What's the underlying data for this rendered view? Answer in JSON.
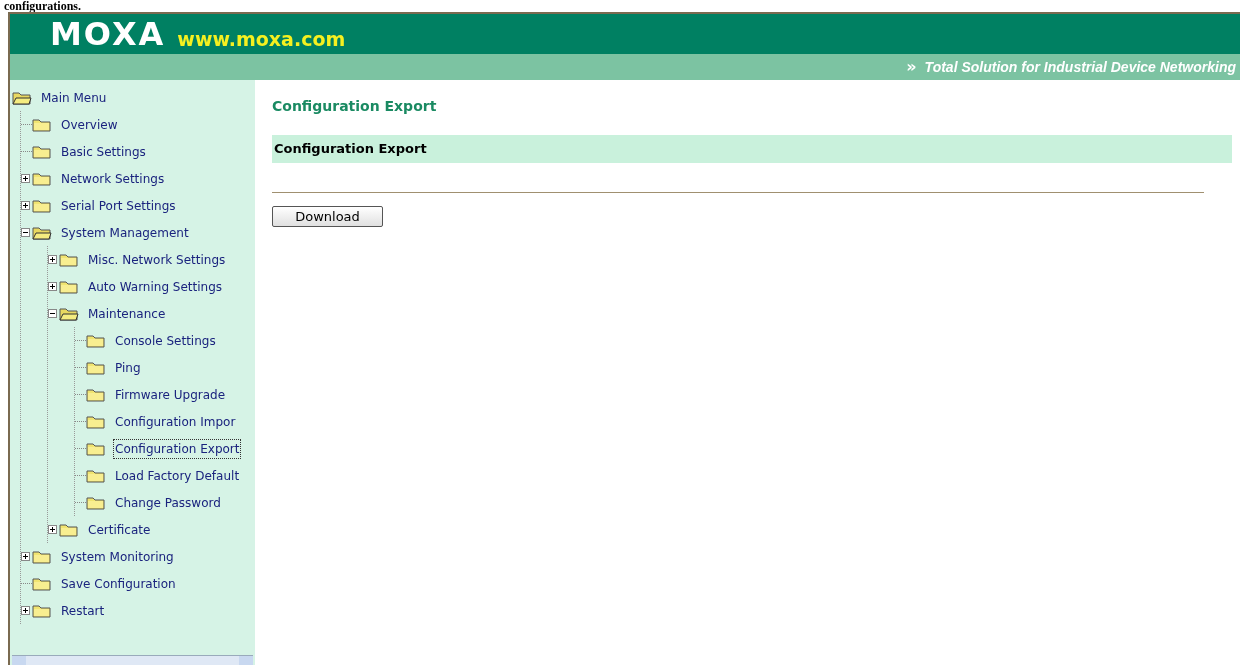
{
  "document_text": "configurations.",
  "header": {
    "logo": "MOXA",
    "url": "www.moxa.com",
    "tagline_icon": "»",
    "tagline": "Total Solution for Industrial Device Networking"
  },
  "sidebar": {
    "items": [
      {
        "label": "Main Menu",
        "selected": false,
        "children": [
          {
            "label": "Overview",
            "selected": false
          },
          {
            "label": "Basic Settings",
            "selected": false
          },
          {
            "label": "Network Settings",
            "selected": false,
            "expanded": false
          },
          {
            "label": "Serial Port Settings",
            "selected": false,
            "expanded": false
          },
          {
            "label": "System Management",
            "selected": false,
            "expanded": true,
            "children": [
              {
                "label": "Misc. Network Settings",
                "selected": false,
                "expanded": false
              },
              {
                "label": "Auto Warning Settings",
                "selected": false,
                "expanded": false
              },
              {
                "label": "Maintenance",
                "selected": false,
                "expanded": true,
                "children": [
                  {
                    "label": "Console Settings",
                    "selected": false
                  },
                  {
                    "label": "Ping",
                    "selected": false
                  },
                  {
                    "label": "Firmware Upgrade",
                    "selected": false
                  },
                  {
                    "label": "Configuration Impor",
                    "selected": false
                  },
                  {
                    "label": "Configuration Export",
                    "selected": true
                  },
                  {
                    "label": "Load Factory Default",
                    "selected": false
                  },
                  {
                    "label": "Change Password",
                    "selected": false
                  }
                ]
              },
              {
                "label": "Certificate",
                "selected": false,
                "expanded": false
              }
            ]
          },
          {
            "label": "System Monitoring",
            "selected": false,
            "expanded": false
          },
          {
            "label": "Save Configuration",
            "selected": false
          },
          {
            "label": "Restart",
            "selected": false,
            "expanded": false
          }
        ]
      }
    ]
  },
  "content": {
    "title": "Configuration Export",
    "section": "Configuration Export",
    "button": "Download"
  }
}
